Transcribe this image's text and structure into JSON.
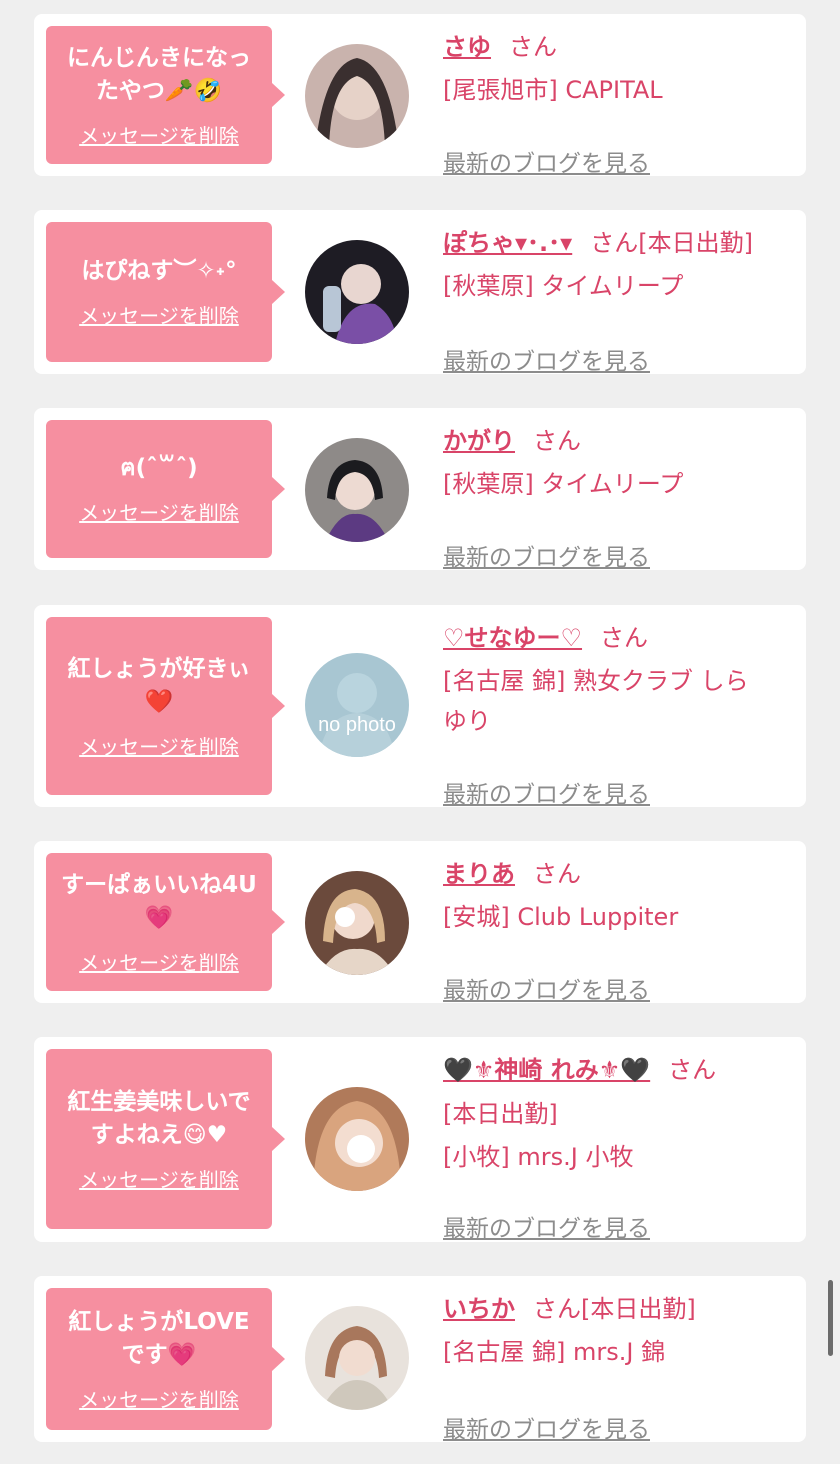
{
  "delete_label": "メッセージを削除",
  "blog_label": "最新のブログを見る",
  "suffix": "さん",
  "cards": [
    {
      "message": "にんじんきになっ\nたやつ🥕🤣",
      "name": "さゆ",
      "status": "",
      "shop": "[尾張旭市] CAPITAL"
    },
    {
      "message": "はぴねす︶✧˖°",
      "name": "ぽちゃ▾･.･▾",
      "status": "[本日出勤]",
      "shop": "[秋葉原] タイムリープ"
    },
    {
      "message": "ฅ(ˆ꒳ˆ)",
      "name": "かがり",
      "status": "",
      "shop": "[秋葉原] タイムリープ"
    },
    {
      "message": "紅しょうが好きぃ\n❤️",
      "name": "♡せなゆー♡",
      "status": "",
      "shop": "[名古屋 錦] 熟女クラブ しら\nゆり"
    },
    {
      "message": "すーぱぁいいね4U\n💗",
      "name": "まりあ",
      "status": "",
      "shop": "[安城] Club Luppiter"
    },
    {
      "message": "紅生姜美味しいで\nすよねえ😋♥",
      "name": "🖤⚜神崎 れみ⚜🖤",
      "status": "",
      "shop": "[本日出勤]\n[小牧] mrs.J 小牧"
    },
    {
      "message": "紅しょうがLOVE\nです💗",
      "name": "いちか",
      "status": "[本日出勤]",
      "shop": "[名古屋 錦] mrs.J 錦"
    }
  ]
}
